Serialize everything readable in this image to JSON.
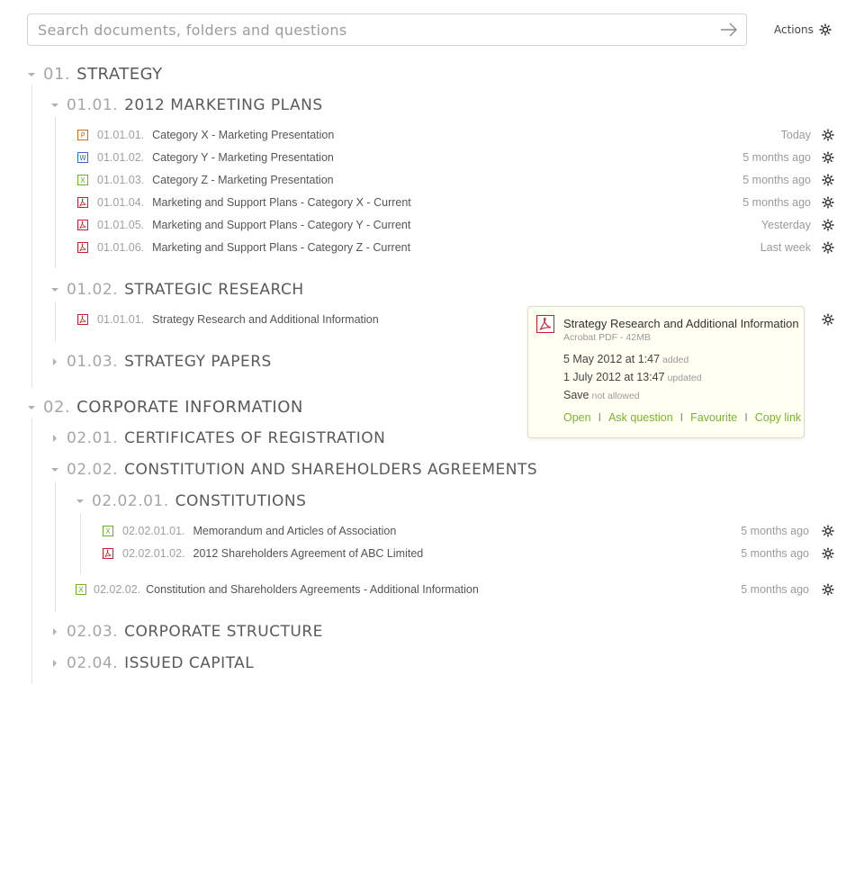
{
  "search": {
    "placeholder": "Search documents, folders and questions"
  },
  "actions": {
    "label": "Actions"
  },
  "colors": {
    "accent": "#7ab32e",
    "pdf": "#c8202b",
    "word": "#2a6fbf",
    "excel": "#6cb02e",
    "ppt": "#d06b1a"
  },
  "sections": [
    {
      "num": "01.",
      "title": "STRATEGY"
    },
    {
      "num": "02.",
      "title": "CORPORATE INFORMATION"
    }
  ],
  "folders": [
    {
      "num": "01.01.",
      "title": "2012 MARKETING PLANS"
    },
    {
      "num": "01.02.",
      "title": "STRATEGIC RESEARCH"
    },
    {
      "num": "01.03.",
      "title": "STRATEGY PAPERS"
    },
    {
      "num": "02.01.",
      "title": "CERTIFICATES OF REGISTRATION"
    },
    {
      "num": "02.02.",
      "title": "CONSTITUTION AND SHAREHOLDERS AGREEMENTS"
    },
    {
      "num": "02.02.01.",
      "title": "CONSTITUTIONS"
    },
    {
      "num": "02.03.",
      "title": "CORPORATE STRUCTURE"
    },
    {
      "num": "02.04.",
      "title": "ISSUED CAPITAL"
    }
  ],
  "docs": [
    {
      "num": "01.01.01.",
      "name": "Category X - Marketing Presentation",
      "date": "Today",
      "icon": "ppt-file-icon"
    },
    {
      "num": "01.01.02.",
      "name": "Category Y - Marketing Presentation",
      "date": "5 months ago",
      "icon": "word-file-icon"
    },
    {
      "num": "01.01.03.",
      "name": "Category Z - Marketing Presentation",
      "date": "5 months ago",
      "icon": "excel-file-icon"
    },
    {
      "num": "01.01.04.",
      "name": "Marketing and Support Plans - Category X - Current",
      "date": "5 months ago",
      "icon": "pdf-file-icon"
    },
    {
      "num": "01.01.05.",
      "name": "Marketing and Support Plans - Category Y - Current",
      "date": "Yesterday",
      "icon": "pdf-file-icon"
    },
    {
      "num": "01.01.06.",
      "name": "Marketing and Support Plans - Category Z - Current",
      "date": "Last week",
      "icon": "pdf-file-icon"
    },
    {
      "num": "01.01.01.",
      "name": "Strategy Research and Additional Information",
      "date": "",
      "icon": "pdf-file-icon"
    },
    {
      "num": "02.02.01.01.",
      "name": "Memorandum and Articles of Association",
      "date": "5 months ago",
      "icon": "excel-file-icon"
    },
    {
      "num": "02.02.01.02.",
      "name": "2012 Shareholders Agreement of ABC Limited",
      "date": "5 months ago",
      "icon": "pdf-file-icon"
    },
    {
      "num": "02.02.02.",
      "name": "Constitution and Shareholders Agreements - Additional Information",
      "date": "5 months ago",
      "icon": "excel-file-icon"
    }
  ],
  "popup": {
    "title": "Strategy Research and Additional Information",
    "meta": "Acrobat PDF - 42MB",
    "added_date": "5 May 2012 at 1:47",
    "added_label": "added",
    "updated_date": "1 July 2012 at 13:47",
    "updated_label": "updated",
    "save_label": "Save",
    "save_status": "not allowed",
    "links": [
      "Open",
      "Ask question",
      "Favourite",
      "Copy link"
    ],
    "separator": "I"
  }
}
